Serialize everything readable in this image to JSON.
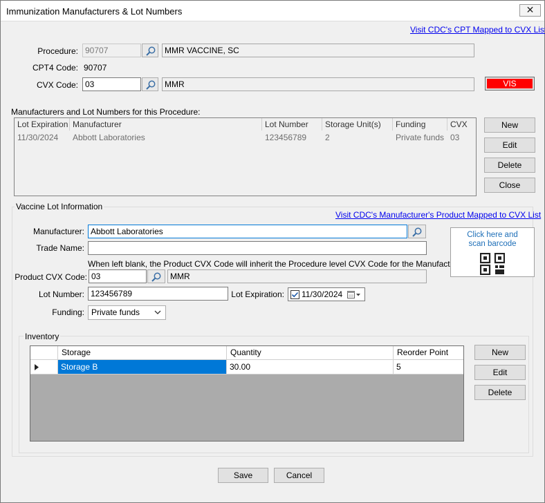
{
  "window": {
    "title": "Immunization Manufacturers & Lot Numbers",
    "close_glyph": "✕"
  },
  "links": {
    "cpt_cvx": "Visit CDC's CPT Mapped to CVX List",
    "mfr_product": "Visit CDC's Manufacturer's Product Mapped to CVX List"
  },
  "procedure": {
    "procedure_label": "Procedure:",
    "procedure_code": "90707",
    "procedure_desc": "MMR VACCINE, SC",
    "cpt4_label": "CPT4 Code:",
    "cpt4_value": "90707",
    "cvx_label": "CVX Code:",
    "cvx_code": "03",
    "cvx_desc": "MMR",
    "vis_label": "VIS"
  },
  "lots": {
    "section_label": "Manufacturers and Lot Numbers for this Procedure:",
    "columns": [
      "Lot Expiration",
      "Manufacturer",
      "Lot Number",
      "Storage Unit(s)",
      "Funding",
      "CVX"
    ],
    "rows": [
      [
        "11/30/2024",
        "Abbott Laboratories",
        "123456789",
        "2",
        "Private funds",
        "03"
      ]
    ],
    "buttons": {
      "new": "New",
      "edit": "Edit",
      "delete": "Delete",
      "close": "Close"
    }
  },
  "lot_info": {
    "group_title": "Vaccine Lot Information",
    "manufacturer_label": "Manufacturer:",
    "manufacturer_value": "Abbott Laboratories",
    "trade_name_label": "Trade Name:",
    "trade_name_value": "",
    "hint": "When left blank, the Product CVX Code will inherit the Procedure level CVX Code for the Manufacturer.",
    "product_cvx_label": "Product CVX Code:",
    "product_cvx_code": "03",
    "product_cvx_desc": "MMR",
    "lot_number_label": "Lot Number:",
    "lot_number_value": "123456789",
    "lot_expiration_label": "Lot Expiration:",
    "lot_expiration_value": "11/30/2024",
    "lot_expiration_checked": true,
    "funding_label": "Funding:",
    "funding_value": "Private funds",
    "barcode_text_1": "Click here and",
    "barcode_text_2": "scan barcode"
  },
  "inventory": {
    "group_title": "Inventory",
    "columns": [
      "Storage",
      "Quantity",
      "Reorder Point"
    ],
    "rows": [
      {
        "storage": "Storage B",
        "quantity": "30.00",
        "reorder_point": "5",
        "selected": true
      }
    ],
    "buttons": {
      "new": "New",
      "edit": "Edit",
      "delete": "Delete"
    }
  },
  "footer": {
    "save": "Save",
    "cancel": "Cancel"
  },
  "colors": {
    "vis_bg": "#ff0000",
    "selection": "#0078d7",
    "link": "#0000ee",
    "barcode_text": "#1e6fb8"
  },
  "icons": [
    "search-icon",
    "close-icon",
    "calendar-icon",
    "chevron-down-icon",
    "qr-code-icon",
    "row-pointer-icon",
    "checkbox-icon"
  ]
}
